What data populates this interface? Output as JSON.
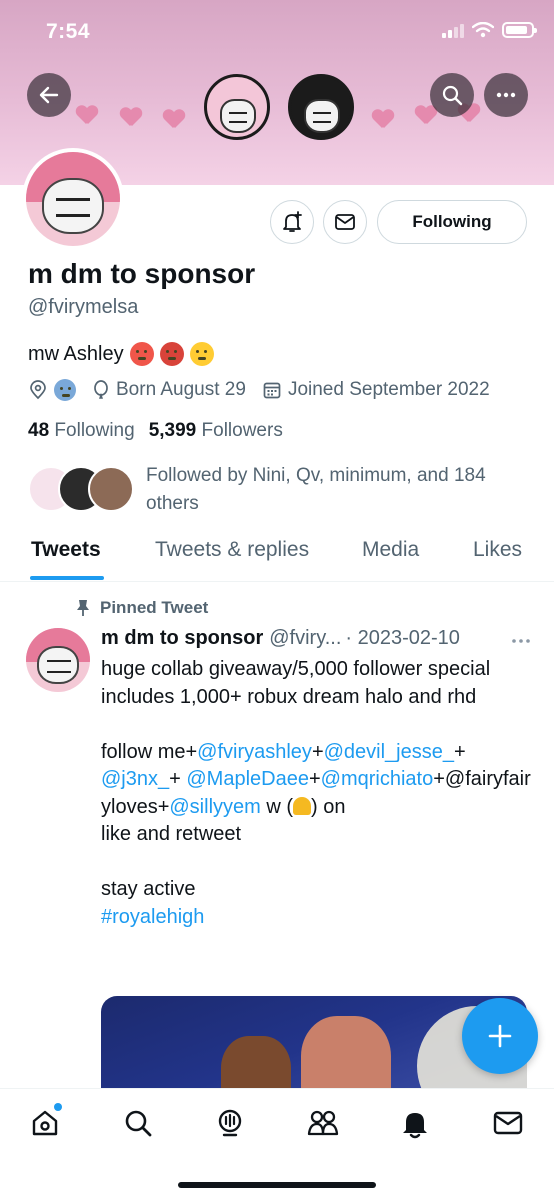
{
  "status_bar": {
    "time": "7:54"
  },
  "profile": {
    "display_name": "m dm to sponsor",
    "handle": "@fvirymelsa",
    "bio": "mw Ashley",
    "born": "Born August 29",
    "joined": "Joined September 2022",
    "following_count": "48",
    "following_label": "Following",
    "followers_count": "5,399",
    "followers_label": "Followers",
    "followed_by": "Followed by Nini, Qv, minimum, and 184 others",
    "follow_button_label": "Following"
  },
  "tabs": [
    {
      "label": "Tweets",
      "active": true
    },
    {
      "label": "Tweets & replies",
      "active": false
    },
    {
      "label": "Media",
      "active": false
    },
    {
      "label": "Likes",
      "active": false
    }
  ],
  "pinned_tweet": {
    "pinned_label": "Pinned Tweet",
    "name": "m dm to sponsor",
    "handle": "@fviry...",
    "date": "· 2023-02-10",
    "line1": "huge collab giveaway/5,000 follower special",
    "line2": "includes 1,000+ robux dream halo and rhd",
    "follow_me": "follow me+",
    "mention1": "@fviryashley",
    "plus1": "+",
    "mention2": "@devil_jesse_",
    "plus2": "+",
    "mention3": "@j3nx_",
    "plus3": "+",
    "mention4": "@MapleDaee",
    "plus4": "+",
    "mention5": "@mqrichiato",
    "plain_mention": "+@fairyfairyloves+",
    "mention6": "@sillyyem",
    "w_text": " w (",
    "on_text": ") on",
    "line_like": "like and retweet",
    "line_stay": "stay active",
    "hashtag": "#royalehigh"
  },
  "colors": {
    "accent": "#1d9bf0",
    "text_primary": "#0f1419",
    "text_secondary": "#536471",
    "banner_pink": "#e7bcd6"
  },
  "icons": {
    "back": "arrow-left-icon",
    "search": "search-icon",
    "more": "more-icon",
    "notify": "bell-plus-icon",
    "message": "envelope-icon",
    "location": "location-pin-icon",
    "birthday": "balloon-icon",
    "calendar": "calendar-icon",
    "pin": "pin-icon",
    "compose": "plus-icon",
    "nav": [
      "home-icon",
      "search-icon",
      "spaces-icon",
      "communities-icon",
      "bell-icon",
      "envelope-icon"
    ]
  }
}
